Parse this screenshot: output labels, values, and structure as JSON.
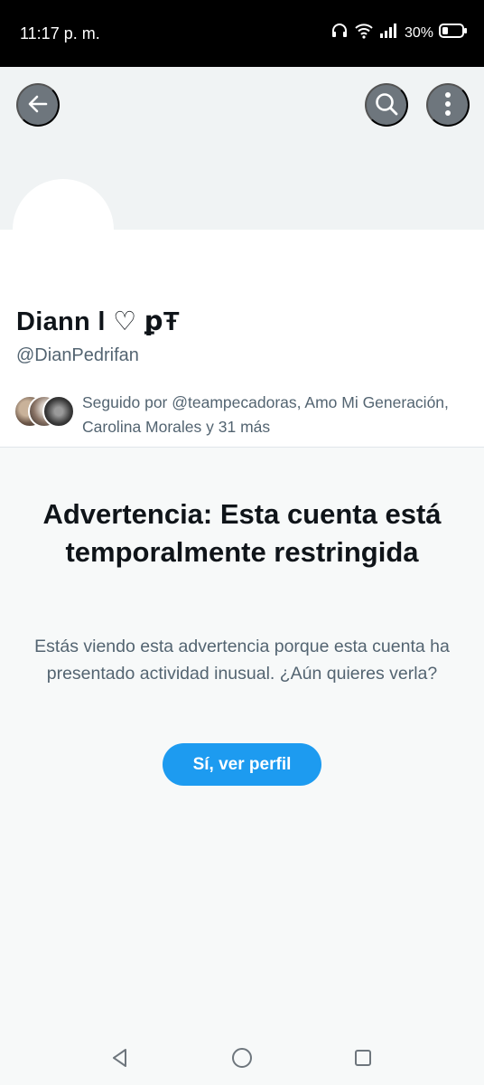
{
  "status_bar": {
    "time": "11:17 p. m.",
    "battery_percent": "30%",
    "battery_level": 0.3,
    "icons": [
      "headphones-icon",
      "wifi-icon",
      "signal-icon",
      "battery-icon"
    ]
  },
  "header": {
    "back_icon": "arrow-left-icon",
    "search_icon": "search-icon",
    "more_icon": "more-vertical-icon"
  },
  "profile": {
    "display_name": "Diann l ♡ ꝑŦ",
    "handle": "@DianPedrifan",
    "followed_by": "Seguido por @teampecadoras, Amo Mi Generación, Carolina Morales y 31 más"
  },
  "warning": {
    "title": "Advertencia: Esta cuenta está temporalmente restringida",
    "body": "Estás viendo esta advertencia porque esta cuenta ha presentado actividad inusual. ¿Aún quieres verla?",
    "button_label": "Sí, ver perfil"
  },
  "nav_bar": {
    "icons": [
      "back-triangle-icon",
      "home-circle-icon",
      "recents-square-icon"
    ]
  },
  "colors": {
    "accent": "#1d9bf0",
    "header_button": "#6e767d",
    "secondary_text": "#536471",
    "background": "#f7f9f9"
  }
}
